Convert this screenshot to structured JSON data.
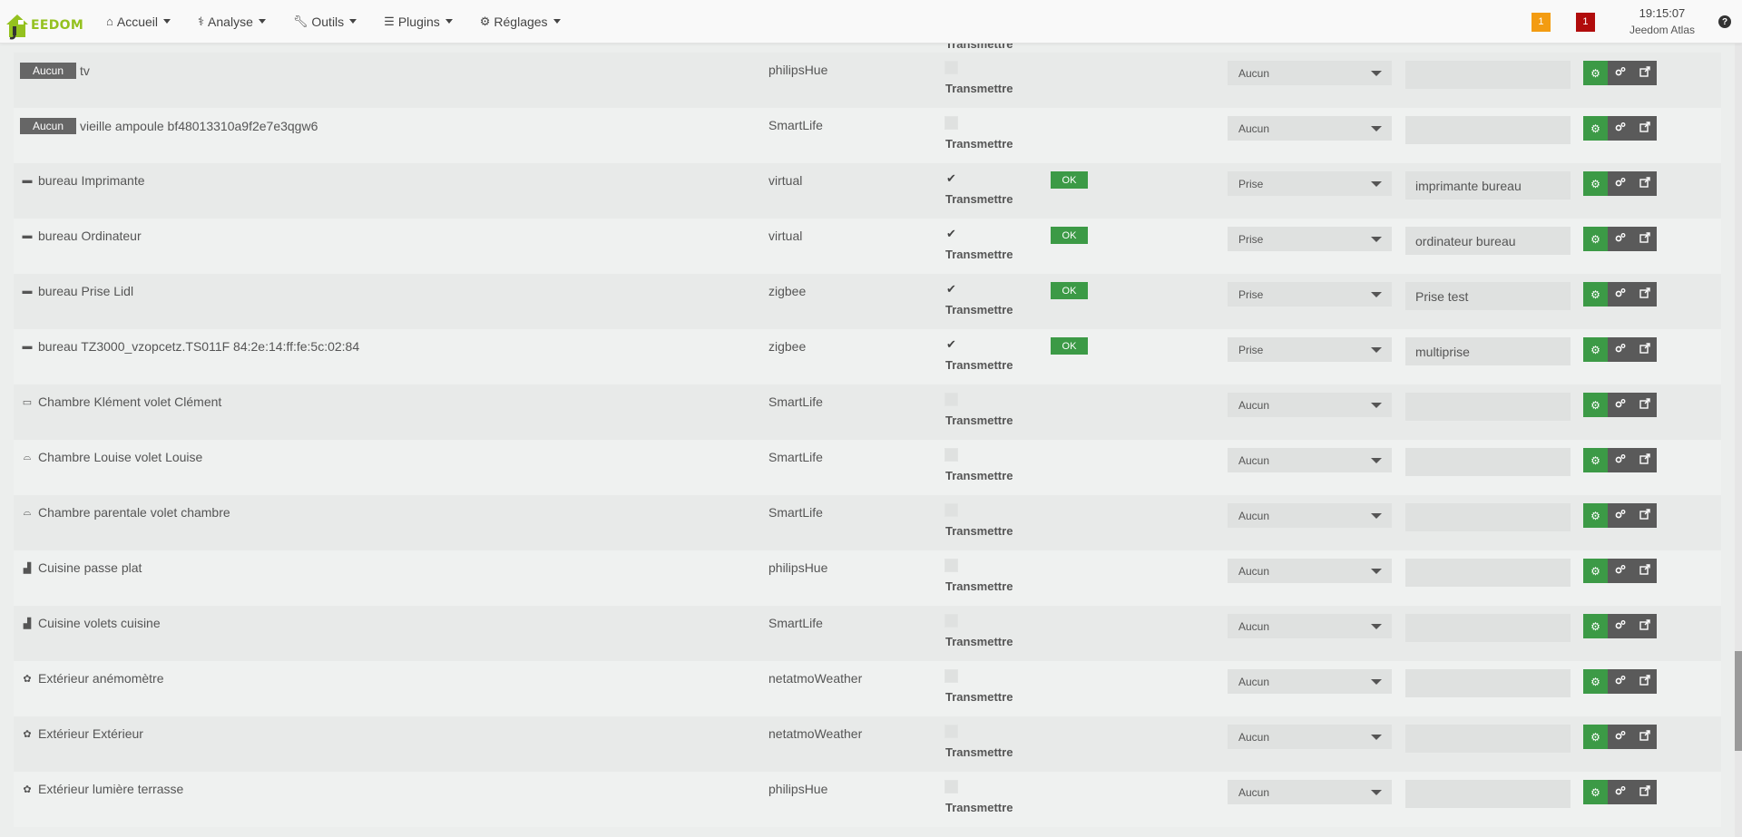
{
  "app": {
    "logo_text": "EEDOM",
    "colors": {
      "brand": "#94c11f",
      "ok": "#3c9a46",
      "warning": "#f39c12",
      "danger": "#b10c0c"
    }
  },
  "nav": {
    "items": [
      {
        "label": "Accueil",
        "icon": "home-icon"
      },
      {
        "label": "Analyse",
        "icon": "stethoscope-icon"
      },
      {
        "label": "Outils",
        "icon": "wrench-icon"
      },
      {
        "label": "Plugins",
        "icon": "tasks-icon"
      },
      {
        "label": "Réglages",
        "icon": "gear-icon"
      }
    ],
    "warning_count": "1",
    "alert_count": "1",
    "time": "19:15:07",
    "system_name": "Jeedom Atlas",
    "help": "?"
  },
  "table": {
    "header_partial": "Transmettre",
    "transmit_label": "Transmettre",
    "ok_label": "OK",
    "rows": [
      {
        "object": "Aucun",
        "object_icon": "",
        "name": "tv",
        "plugin": "philipsHue",
        "checked": false,
        "ok": false,
        "type": "Aucun",
        "alias": ""
      },
      {
        "object": "Aucun",
        "object_icon": "",
        "name": "vieille ampoule bf48013310a9f2e7e3qgw6",
        "plugin": "SmartLife",
        "checked": false,
        "ok": false,
        "type": "Aucun",
        "alias": ""
      },
      {
        "object": "",
        "object_icon": "desk-icon",
        "name": "bureau Imprimante",
        "plugin": "virtual",
        "checked": true,
        "ok": true,
        "type": "Prise",
        "alias": "imprimante bureau"
      },
      {
        "object": "",
        "object_icon": "desk-icon",
        "name": "bureau Ordinateur",
        "plugin": "virtual",
        "checked": true,
        "ok": true,
        "type": "Prise",
        "alias": "ordinateur bureau"
      },
      {
        "object": "",
        "object_icon": "desk-icon",
        "name": "bureau Prise Lidl",
        "plugin": "zigbee",
        "checked": true,
        "ok": true,
        "type": "Prise",
        "alias": "Prise test"
      },
      {
        "object": "",
        "object_icon": "desk-icon",
        "name": "bureau TZ3000_vzopcetz.TS011F 84:2e:14:ff:fe:5c:02:84",
        "plugin": "zigbee",
        "checked": true,
        "ok": true,
        "type": "Prise",
        "alias": "multiprise"
      },
      {
        "object": "",
        "object_icon": "laptop-icon",
        "name": "Chambre Klément volet Clément",
        "plugin": "SmartLife",
        "checked": false,
        "ok": false,
        "type": "Aucun",
        "alias": ""
      },
      {
        "object": "",
        "object_icon": "bed-icon",
        "name": "Chambre Louise volet Louise",
        "plugin": "SmartLife",
        "checked": false,
        "ok": false,
        "type": "Aucun",
        "alias": ""
      },
      {
        "object": "",
        "object_icon": "bed-icon",
        "name": "Chambre parentale volet chambre",
        "plugin": "SmartLife",
        "checked": false,
        "ok": false,
        "type": "Aucun",
        "alias": ""
      },
      {
        "object": "",
        "object_icon": "kitchen-icon",
        "name": "Cuisine passe plat",
        "plugin": "philipsHue",
        "checked": false,
        "ok": false,
        "type": "Aucun",
        "alias": ""
      },
      {
        "object": "",
        "object_icon": "kitchen-icon",
        "name": "Cuisine volets cuisine",
        "plugin": "SmartLife",
        "checked": false,
        "ok": false,
        "type": "Aucun",
        "alias": ""
      },
      {
        "object": "",
        "object_icon": "flower-icon",
        "name": "Extérieur anémomètre",
        "plugin": "netatmoWeather",
        "checked": false,
        "ok": false,
        "type": "Aucun",
        "alias": ""
      },
      {
        "object": "",
        "object_icon": "flower-icon",
        "name": "Extérieur Extérieur",
        "plugin": "netatmoWeather",
        "checked": false,
        "ok": false,
        "type": "Aucun",
        "alias": ""
      },
      {
        "object": "",
        "object_icon": "flower-icon",
        "name": "Extérieur lumière terrasse",
        "plugin": "philipsHue",
        "checked": false,
        "ok": false,
        "type": "Aucun",
        "alias": ""
      }
    ]
  }
}
